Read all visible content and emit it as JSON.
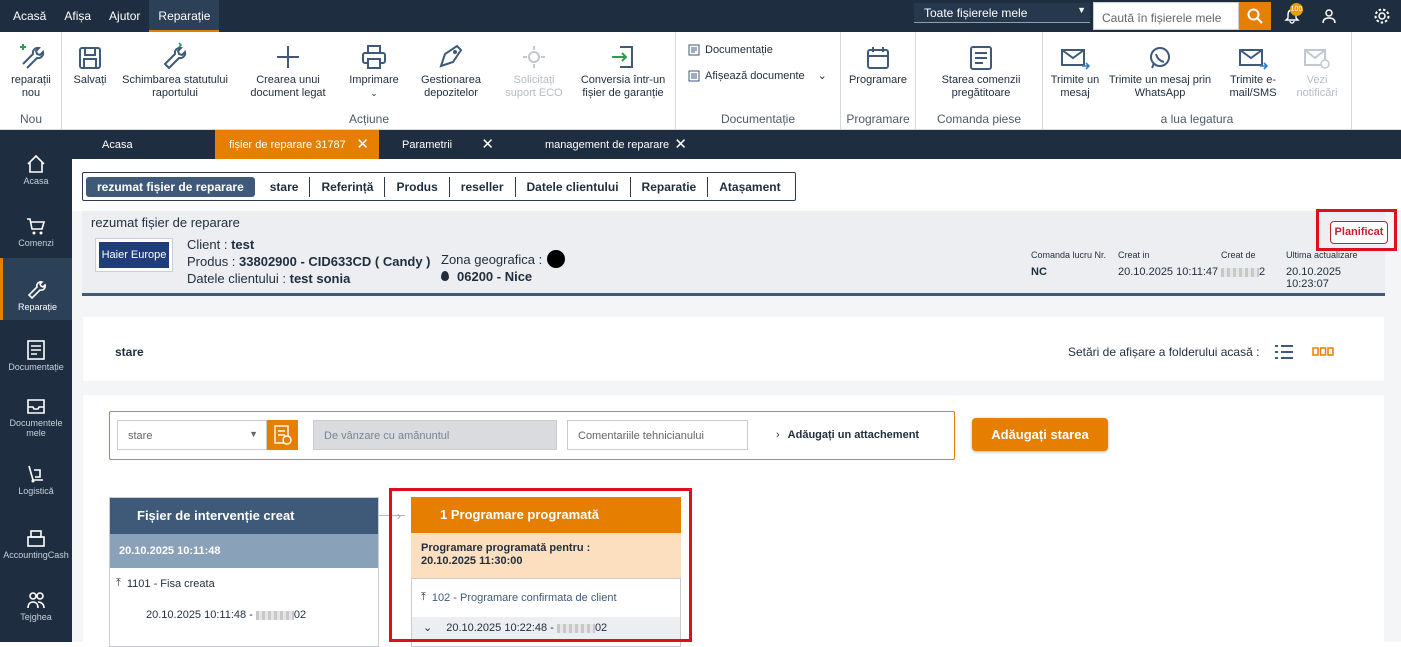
{
  "topmenu": [
    "Acasă",
    "Afișa",
    "Ajutor",
    "Reparație"
  ],
  "file_select": "Toate fișierele mele",
  "search_placeholder": "Caută în fișierele mele",
  "notif_count": "100",
  "ribbon": {
    "new_label": "reparații nou",
    "new_group": "Nou",
    "save": "Salvați",
    "change_status": "Schimbarea statutului raportului",
    "create_doc": "Crearea unui document legat",
    "print": "Imprimare",
    "deposits": "Gestionarea depozitelor",
    "eco": "Solicitați suport ECO",
    "convert": "Conversia într-un fișier de garanție",
    "actions_group": "Acțiune",
    "docs": "Documentație",
    "show_docs": "Afișează documente",
    "docs_group": "Documentație",
    "schedule": "Programare",
    "schedule_group": "Programare",
    "parts_status": "Starea comenzii pregătitoare",
    "parts_group": "Comanda piese",
    "send_msg": "Trimite un mesaj",
    "send_wa": "Trimite un mesaj prin WhatsApp",
    "send_mail": "Trimite e-mail/SMS",
    "view_notif": "Vezi notificări",
    "contact_group": "a lua legatura"
  },
  "sidebar": [
    "Acasa",
    "Comenzi",
    "Reparație",
    "Documentație",
    "Documentele mele",
    "Logistică",
    "AccountingCash",
    "Tejghea"
  ],
  "tabs": [
    {
      "label": "Acasa"
    },
    {
      "label": "fișier de reparare 31787"
    },
    {
      "label": "Parametrii"
    },
    {
      "label": "management de reparare"
    }
  ],
  "subtabs": [
    "rezumat fișier de reparare",
    "stare",
    "Referință",
    "Produs",
    "reseller",
    "Datele clientului",
    "Reparatie",
    "Atașament"
  ],
  "summary": {
    "title": "rezumat fișier de reparare",
    "brand": "Haier Europe",
    "client_label": "Client : ",
    "client": "test",
    "product_label": "Produs : ",
    "product": "33802900  -  CID633CD ( Candy )",
    "contact_label": "Datele clientului : ",
    "contact": "test sonia",
    "zone_label": "Zona geografica :",
    "postal": "06200  -  Nice",
    "status": "Planificat",
    "cols": [
      {
        "label": "Comanda lucru Nr.",
        "value": "NC"
      },
      {
        "label": "Creat in",
        "value": "20.10.2025 10:11:47"
      },
      {
        "label": "Creat de",
        "value": "2"
      },
      {
        "label": "Ultima actualizare",
        "value": "20.10.2025 10:23:07"
      }
    ]
  },
  "stare": {
    "title": "stare",
    "display_settings": "Setări de afișare a folderului acasă :"
  },
  "form": {
    "status_placeholder": "stare",
    "type_value": "De vânzare cu amănuntul",
    "comment_placeholder": "Comentariile tehnicianului",
    "attach": "Adăugați un attachement",
    "add_button": "Adăugați starea"
  },
  "card1": {
    "title": "Fișier de intervenție creat",
    "date": "20.10.2025 10:11:48",
    "entry": "1101 - Fisa creata",
    "entry_date": "20.10.2025 10:11:48  -  ",
    "entry_user": "02"
  },
  "card2": {
    "title": "1 Programare programată",
    "sub1": "Programare programată pentru :",
    "sub2": "20.10.2025 11:30:00",
    "entry": "102 - Programare confirmata de client",
    "entry_date": "20.10.2025 10:22:48  -  ",
    "entry_user": "02"
  }
}
